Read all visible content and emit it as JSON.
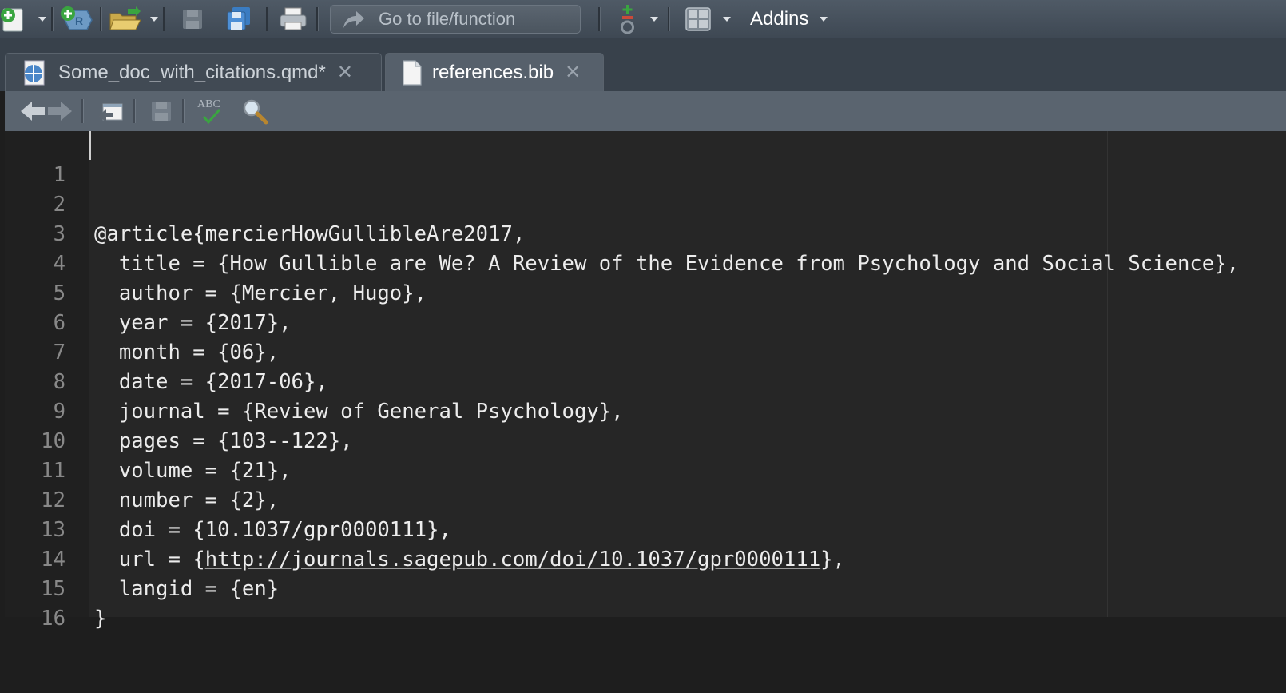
{
  "toolbar": {
    "goto_placeholder": "Go to file/function",
    "addins_label": "Addins"
  },
  "tabs": [
    {
      "label": "Some_doc_with_citations.qmd*",
      "active": false
    },
    {
      "label": "references.bib",
      "active": true
    }
  ],
  "editor_toolbar": {
    "spellcheck_icon_text": "ABC"
  },
  "editor": {
    "lines": [
      {
        "num": "1",
        "text": ""
      },
      {
        "num": "2",
        "text": "@article{mercierHowGullibleAre2017,"
      },
      {
        "num": "3",
        "text": "  title = {How Gullible are We? A Review of the Evidence from Psychology and Social Science},"
      },
      {
        "num": "4",
        "text": "  author = {Mercier, Hugo},"
      },
      {
        "num": "5",
        "text": "  year = {2017},"
      },
      {
        "num": "6",
        "text": "  month = {06},"
      },
      {
        "num": "7",
        "text": "  date = {2017-06},"
      },
      {
        "num": "8",
        "text": "  journal = {Review of General Psychology},"
      },
      {
        "num": "9",
        "text": "  pages = {103--122},"
      },
      {
        "num": "10",
        "text": "  volume = {21},"
      },
      {
        "num": "11",
        "text": "  number = {2},"
      },
      {
        "num": "12",
        "text": "  doi = {10.1037/gpr0000111},"
      },
      {
        "num": "13",
        "text_before": "  url = {",
        "link": "http://journals.sagepub.com/doi/10.1037/gpr0000111",
        "text_after": "},"
      },
      {
        "num": "14",
        "text": "  langid = {en}"
      },
      {
        "num": "15",
        "text": "}"
      },
      {
        "num": "16",
        "text": ""
      }
    ]
  },
  "colors": {
    "editor_bg": "#262626",
    "toolbar_bg": "#4f5a66",
    "active_tab_bg": "#56606b",
    "text": "#ececec",
    "line_number": "#888888"
  }
}
